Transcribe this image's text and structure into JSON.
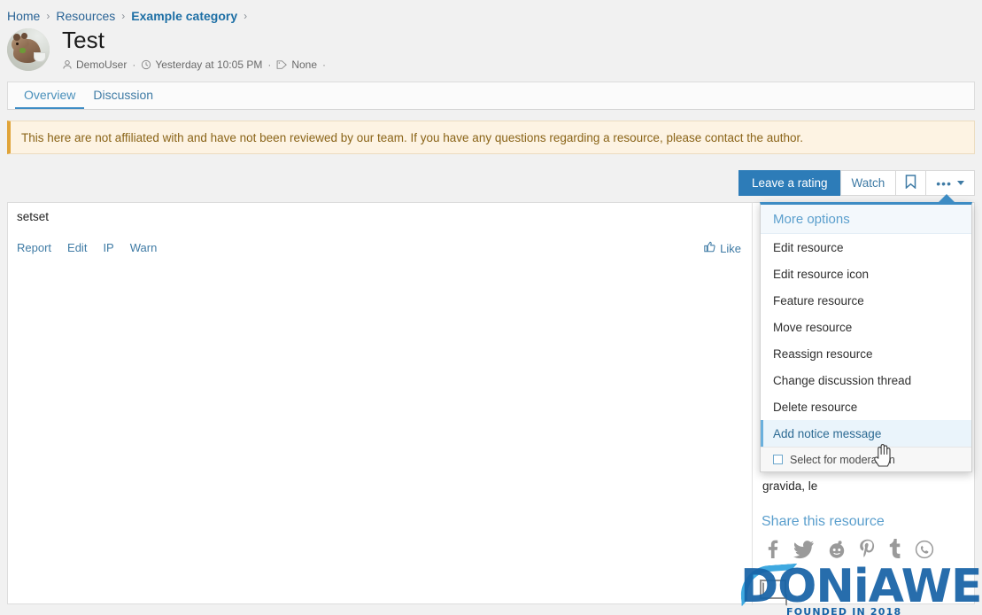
{
  "breadcrumb": {
    "items": [
      {
        "label": "Home",
        "current": false
      },
      {
        "label": "Resources",
        "current": false
      },
      {
        "label": "Example category",
        "current": true
      }
    ],
    "separator": "›"
  },
  "header": {
    "title": "Test",
    "avatar_alt": "hamster-avatar",
    "meta": {
      "author": "DemoUser",
      "date": "Yesterday at 10:05 PM",
      "tag": "None",
      "separator": "·",
      "trailing_separator": "·"
    }
  },
  "tabs": [
    {
      "label": "Overview",
      "active": true
    },
    {
      "label": "Discussion",
      "active": false
    }
  ],
  "notice": {
    "text": "This here are not affiliated with and have not been reviewed by our team. If you have any questions regarding a resource, please contact the author.",
    "border_color": "#e0a43a",
    "background": "#fdf3e3"
  },
  "actions": {
    "rate_label": "Leave a rating",
    "watch_label": "Watch",
    "bookmark_icon": "bookmark-icon",
    "more_icon": "ellipsis-icon",
    "primary_color": "#2d7cb8"
  },
  "post": {
    "body": "setset",
    "links": [
      "Report",
      "Edit",
      "IP",
      "Warn"
    ],
    "like_label": "Like",
    "like_icon": "thumbs-up-icon"
  },
  "sidebar": {
    "excerpt": "gravida, le",
    "share_title": "Share this resource",
    "share_icons": [
      {
        "name": "facebook-icon",
        "glyph": "f"
      },
      {
        "name": "twitter-icon",
        "glyph": "t"
      },
      {
        "name": "reddit-icon",
        "glyph": "r"
      },
      {
        "name": "pinterest-icon",
        "glyph": "p"
      },
      {
        "name": "tumblr-icon",
        "glyph": "tu"
      },
      {
        "name": "whatsapp-icon",
        "glyph": "w"
      }
    ]
  },
  "menu": {
    "header": "More options",
    "items": [
      {
        "label": "Edit resource",
        "highlight": false
      },
      {
        "label": "Edit resource icon",
        "highlight": false
      },
      {
        "label": "Feature resource",
        "highlight": false
      },
      {
        "label": "Move resource",
        "highlight": false
      },
      {
        "label": "Reassign resource",
        "highlight": false
      },
      {
        "label": "Change discussion thread",
        "highlight": false
      },
      {
        "label": "Delete resource",
        "highlight": false
      },
      {
        "label": "Add notice message",
        "highlight": true
      }
    ],
    "footer": {
      "checkbox_label": "Select for moderation",
      "checked": false
    },
    "accent_color": "#3d8cc4"
  },
  "watermark": {
    "text": "DONiAWEB",
    "subtitle": "FOUNDED IN 2018",
    "color": "#1763a6"
  }
}
